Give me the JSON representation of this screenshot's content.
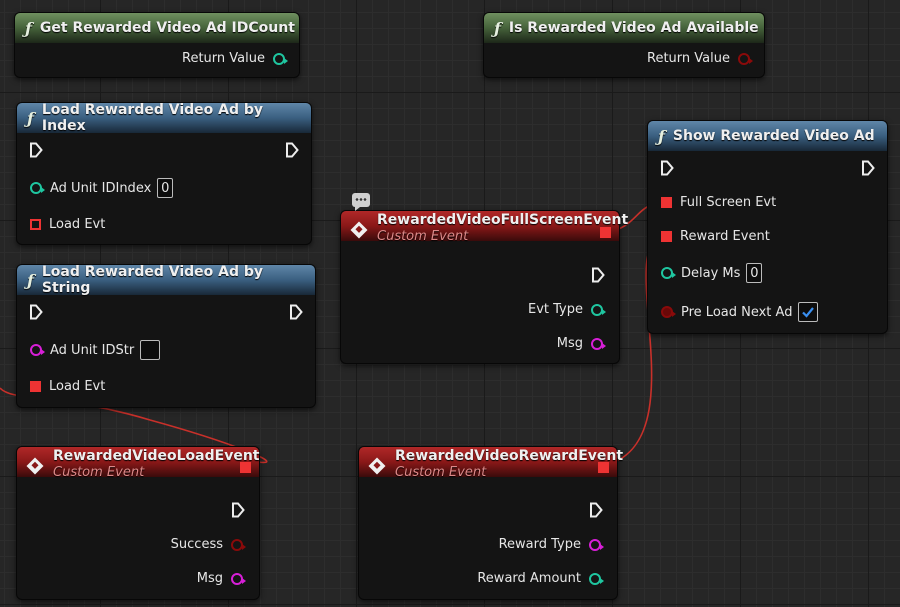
{
  "nodes": {
    "get_count": {
      "title": "Get Rewarded Video Ad IDCount",
      "return_label": "Return Value"
    },
    "is_available": {
      "title": "Is Rewarded Video Ad Available",
      "return_label": "Return Value"
    },
    "load_by_index": {
      "title": "Load Rewarded Video Ad by Index",
      "ad_unit_label": "Ad Unit IDIndex",
      "ad_unit_value": "0",
      "load_evt_label": "Load Evt"
    },
    "load_by_string": {
      "title": "Load Rewarded Video Ad by String",
      "ad_unit_label": "Ad Unit IDStr",
      "ad_unit_value": "",
      "load_evt_label": "Load Evt"
    },
    "fullscreen_event": {
      "title": "RewardedVideoFullScreenEvent",
      "subtitle": "Custom Event",
      "evt_type_label": "Evt Type",
      "msg_label": "Msg"
    },
    "show_ad": {
      "title": "Show Rewarded Video Ad",
      "full_screen_label": "Full Screen Evt",
      "reward_label": "Reward Event",
      "delay_label": "Delay Ms",
      "delay_value": "0",
      "preload_label": "Pre Load Next Ad",
      "preload_checked": true
    },
    "load_event": {
      "title": "RewardedVideoLoadEvent",
      "subtitle": "Custom Event",
      "success_label": "Success",
      "msg_label": "Msg"
    },
    "reward_event": {
      "title": "RewardedVideoRewardEvent",
      "subtitle": "Custom Event",
      "reward_type_label": "Reward Type",
      "reward_amount_label": "Reward Amount"
    }
  },
  "colors": {
    "delegate_wire": "#d83030",
    "pin_int": "#1fc6a0",
    "pin_string": "#d81fd8",
    "pin_bool": "#8a0a0a",
    "header_pure": "#45623a",
    "header_function": "#3a5f80",
    "header_event": "#8a1818"
  },
  "icons": {
    "function": "f-function-icon",
    "event": "diamond-event-icon",
    "comment": "comment-bubble-icon",
    "exec": "exec-arrow-icon",
    "check": "checkmark-icon"
  }
}
